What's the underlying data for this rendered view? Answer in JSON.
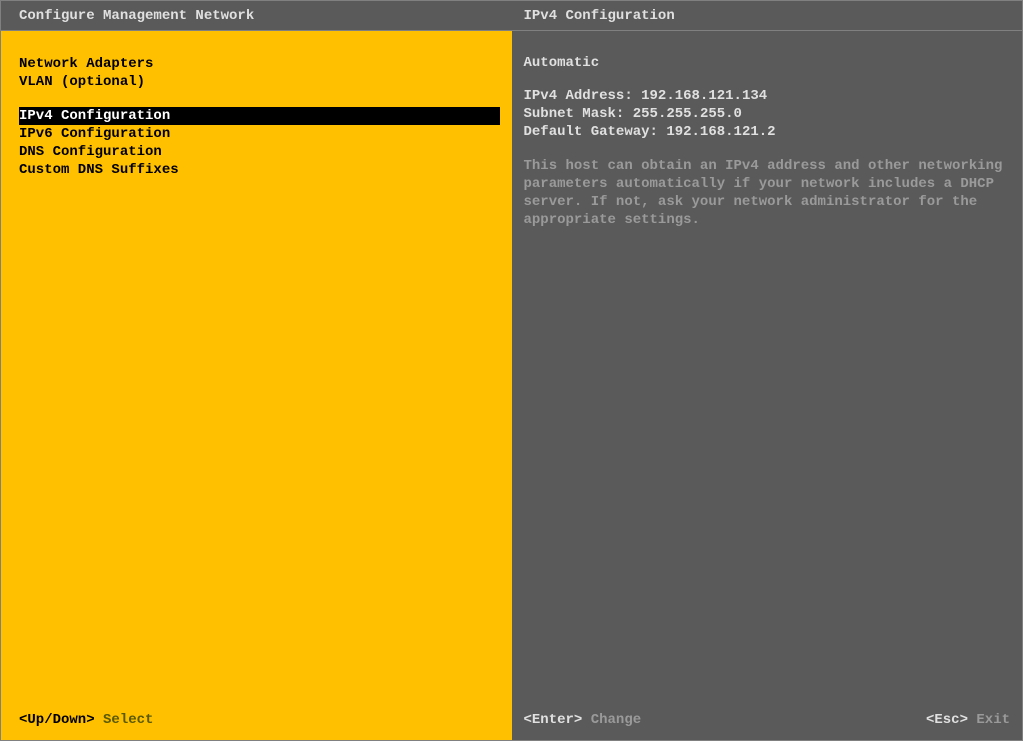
{
  "left": {
    "title": "Configure Management Network",
    "group1": {
      "items": [
        "Network Adapters",
        "VLAN (optional)"
      ]
    },
    "group2": {
      "items": [
        "IPv4 Configuration",
        "IPv6 Configuration",
        "DNS Configuration",
        "Custom DNS Suffixes"
      ],
      "selectedIndex": 0
    },
    "footer": {
      "key": "<Up/Down>",
      "action": "Select"
    }
  },
  "right": {
    "title": "IPv4 Configuration",
    "mode": "Automatic",
    "details": {
      "ipv4_label": "IPv4 Address:",
      "ipv4_value": "192.168.121.134",
      "mask_label": "Subnet Mask:",
      "mask_value": "255.255.255.0",
      "gw_label": "Default Gateway:",
      "gw_value": "192.168.121.2"
    },
    "help": "This host can obtain an IPv4 address and other networking parameters automatically if your network includes a DHCP server. If not, ask your network administrator for the appropriate settings.",
    "footer": {
      "left_key": "<Enter>",
      "left_action": "Change",
      "right_key": "<Esc>",
      "right_action": "Exit"
    }
  }
}
